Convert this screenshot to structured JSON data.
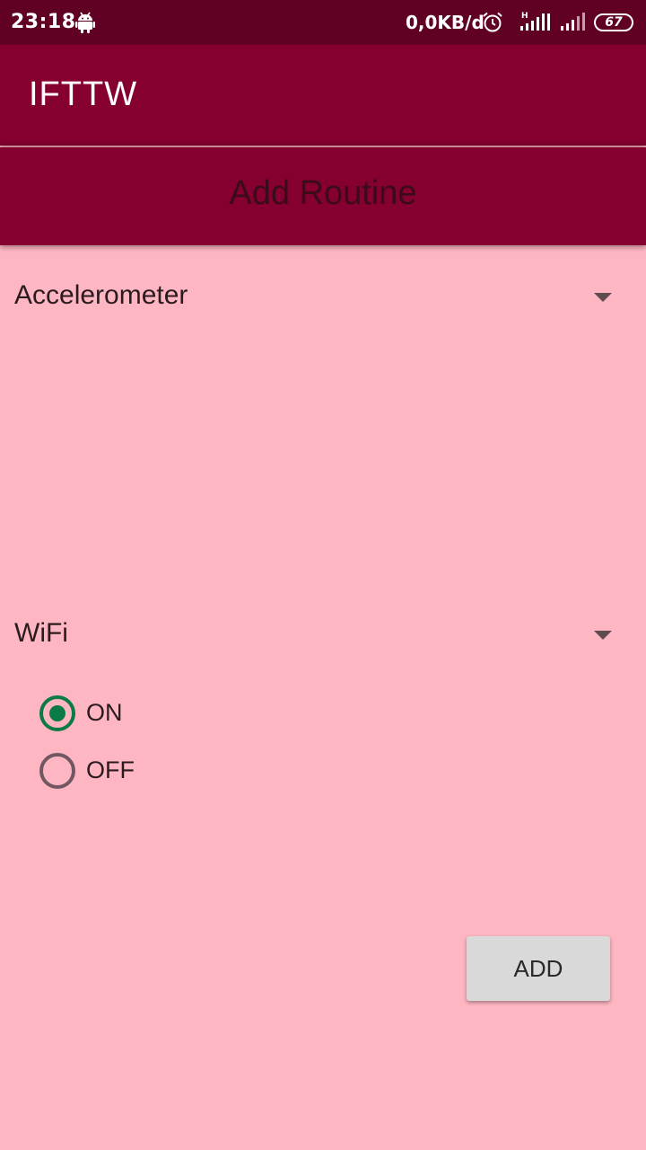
{
  "status_bar": {
    "time": "23:18",
    "net_speed": "0,0KB/d",
    "battery": "67",
    "signal_label": "H",
    "icons": [
      "android-icon",
      "alarm-icon",
      "signal-icon",
      "signal-icon",
      "battery-icon"
    ]
  },
  "app_bar": {
    "title": "IFTTW"
  },
  "header": {
    "title": "Add Routine"
  },
  "trigger_spinner": {
    "selected": "Accelerometer"
  },
  "action_spinner": {
    "selected": "WiFi"
  },
  "wifi_radio": {
    "options": [
      {
        "label": "ON",
        "checked": true
      },
      {
        "label": "OFF",
        "checked": false
      }
    ]
  },
  "add_button": {
    "label": "ADD"
  },
  "colors": {
    "status_bar": "#5f0024",
    "app_bar": "#850031",
    "background": "#ffb6c3",
    "radio_checked": "#0a7a46",
    "button": "#d9d9d9"
  }
}
